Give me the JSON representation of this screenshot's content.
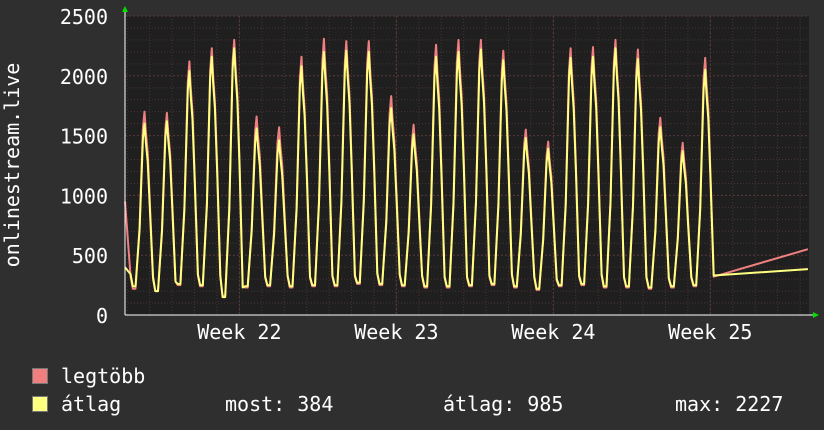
{
  "chart_data": {
    "type": "line",
    "ylabel": "onlinestream.live",
    "ylim": [
      0,
      2500
    ],
    "yticks": [
      0,
      500,
      1000,
      1500,
      2000,
      2500
    ],
    "x_tick_labels": [
      "Week 22",
      "Week 23",
      "Week 24",
      "Week 25"
    ],
    "x_tick_days": [
      5.1,
      12.1,
      19.1,
      26.1
    ],
    "x_range_days": [
      0,
      30.5
    ],
    "grid": true,
    "legend_position": "bottom-left",
    "colors": {
      "background": "#2f2f2f",
      "plot_background": "#1f1f1f",
      "grid_major": "#5a3a3a",
      "grid_minor": "#4a3333",
      "axis": "#ffffff",
      "arrow": "#00e000"
    },
    "series": [
      {
        "name": "legtöbb",
        "color": "#f08080",
        "daily_peaks": [
          1700,
          1690,
          2120,
          2230,
          2300,
          1660,
          1570,
          2160,
          2310,
          2290,
          2290,
          1830,
          1590,
          2260,
          2300,
          2300,
          2210,
          1550,
          1450,
          2230,
          2240,
          2300,
          2220,
          1650,
          1440,
          2150
        ],
        "daily_troughs": [
          220,
          200,
          250,
          240,
          160,
          230,
          240,
          230,
          240,
          240,
          260,
          250,
          240,
          230,
          230,
          240,
          250,
          230,
          210,
          240,
          250,
          230,
          230,
          220,
          230,
          240
        ],
        "start_value": 950,
        "end_value": 550
      },
      {
        "name": "átlag",
        "color": "#ffff80",
        "daily_peaks": [
          1600,
          1620,
          2040,
          2160,
          2230,
          1560,
          1460,
          2080,
          2200,
          2210,
          2200,
          1730,
          1510,
          2160,
          2200,
          2220,
          2130,
          1480,
          1390,
          2150,
          2160,
          2230,
          2140,
          1570,
          1370,
          2050
        ],
        "daily_troughs": [
          240,
          200,
          260,
          250,
          150,
          240,
          250,
          240,
          250,
          250,
          270,
          260,
          250,
          240,
          240,
          250,
          260,
          240,
          220,
          250,
          260,
          240,
          240,
          230,
          240,
          250
        ],
        "start_value": 400,
        "end_value": 384
      }
    ]
  },
  "legend": {
    "items": [
      {
        "label": "legtöbb",
        "color": "#f08080"
      },
      {
        "label": "átlag",
        "color": "#ffff80"
      }
    ],
    "stats": {
      "most": "most: 384",
      "atlag": "átlag: 985",
      "max": "max: 2227"
    }
  }
}
